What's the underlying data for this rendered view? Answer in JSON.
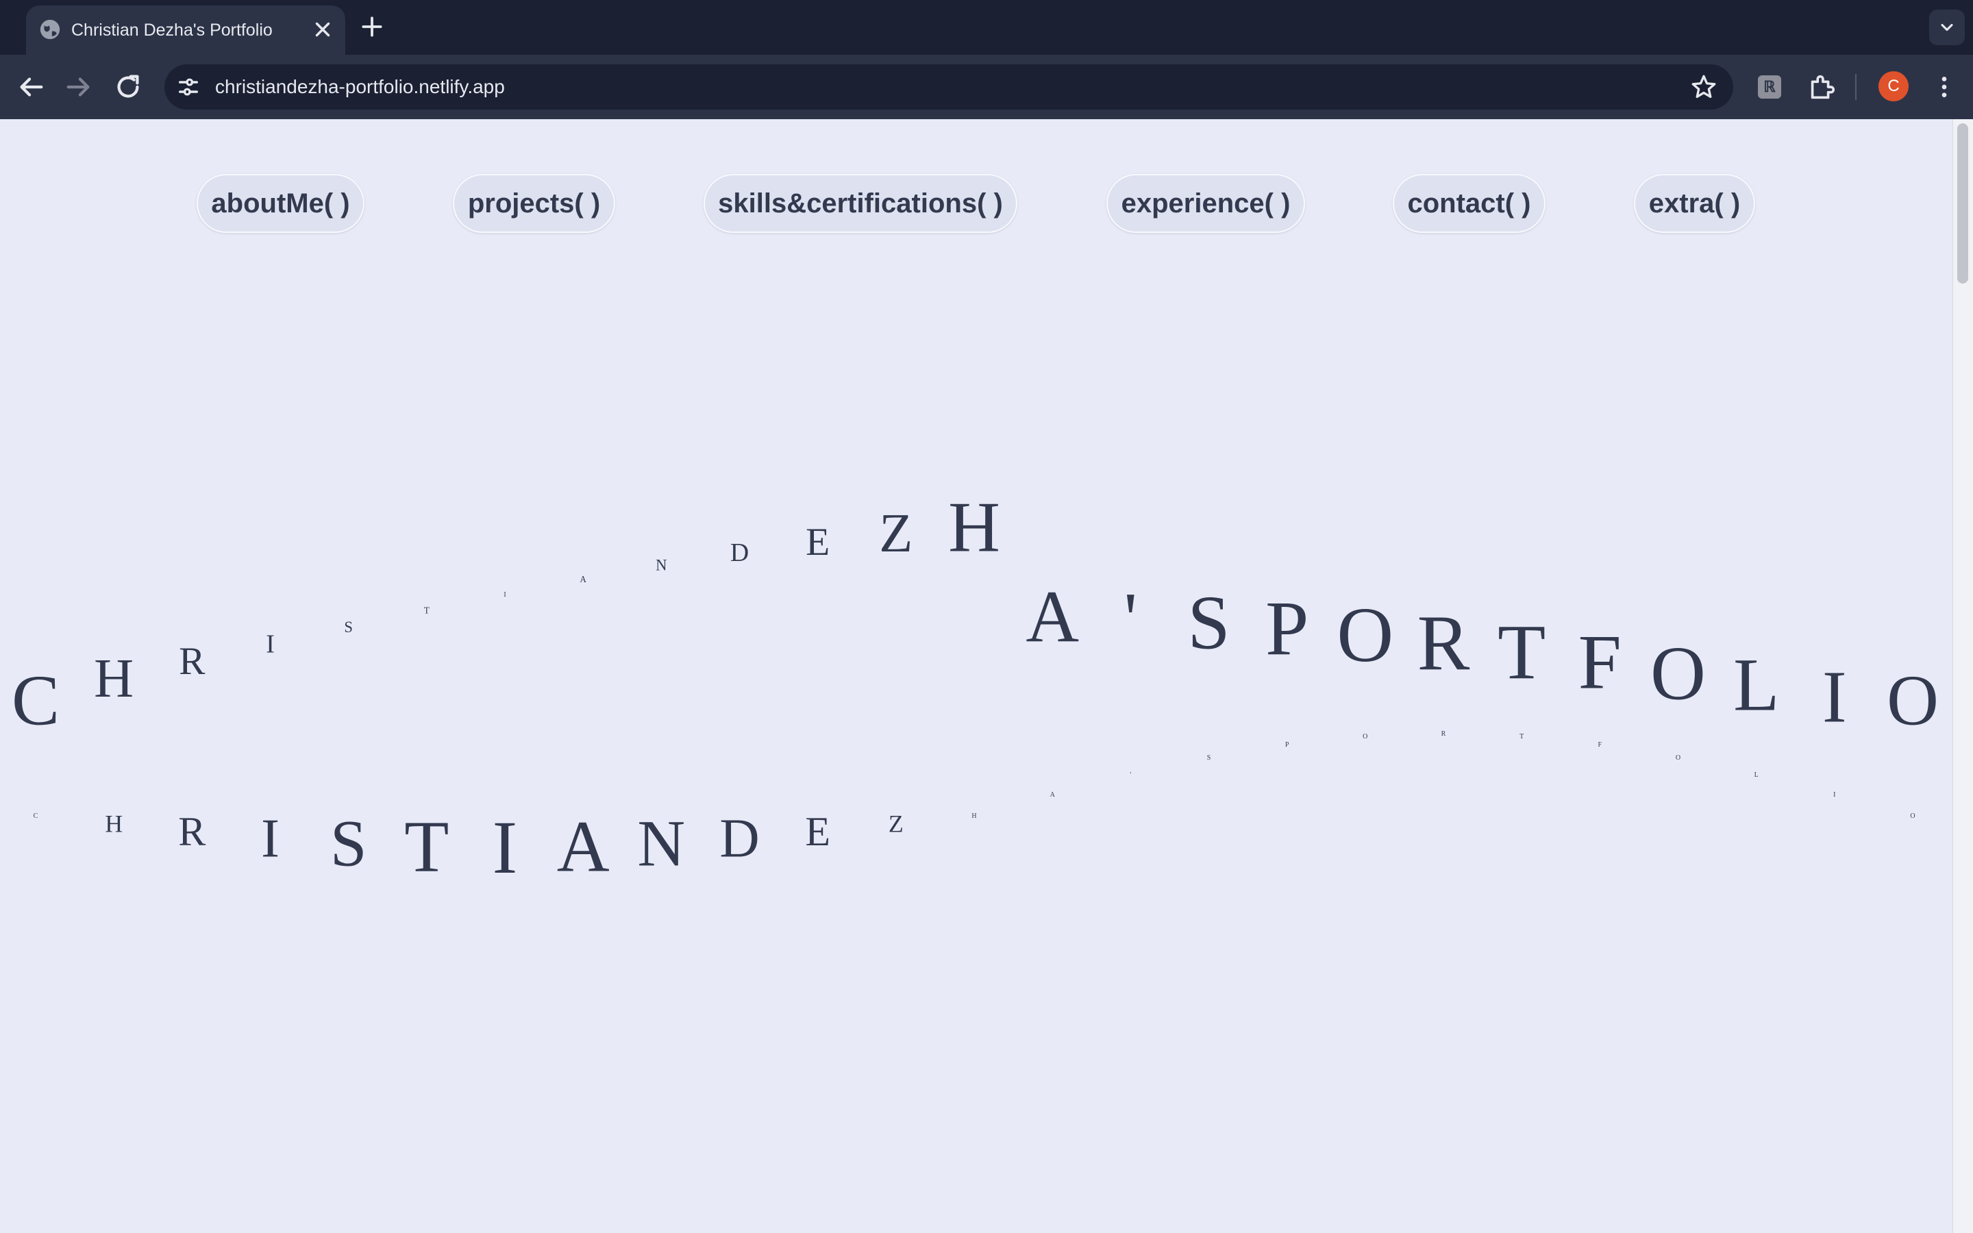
{
  "browser": {
    "tab_title": "Christian Dezha's Portfolio",
    "url": "christiandezha-portfolio.netlify.app",
    "profile_initial": "C",
    "extension_label": "ℝ"
  },
  "nav": {
    "items": [
      {
        "label": "aboutMe( )"
      },
      {
        "label": "projects( )"
      },
      {
        "label": "skills&certifications( )"
      },
      {
        "label": "experience( )"
      },
      {
        "label": "contact( )"
      },
      {
        "label": "extra( )"
      }
    ]
  },
  "hero": {
    "text": "CHRISTIANDEZHA'SPORTFOLIO"
  },
  "colors": {
    "page_bg": "#e8ebf7",
    "text": "#333a4f",
    "chrome_dark": "#1b2033",
    "chrome_mid": "#2d3347",
    "avatar": "#e0522b"
  }
}
